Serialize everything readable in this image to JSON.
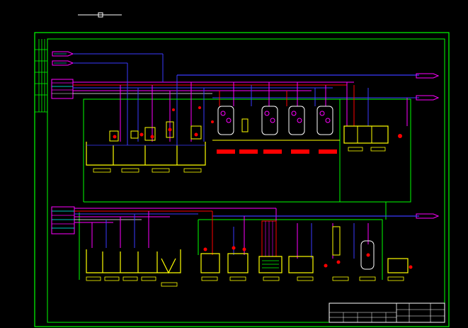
{
  "drawing": {
    "background": "#000000",
    "colors": {
      "frame": "#00ff00",
      "pipe_magenta": "#ff00ff",
      "pipe_red": "#ff0000",
      "pipe_blue": "#3a3aff",
      "vessel": "#ffff00",
      "valve": "#ff0000",
      "white": "#ffffff",
      "cyan": "#00ffff"
    },
    "title_block": {
      "cells": [
        "",
        "",
        "",
        "",
        "",
        "",
        "",
        "",
        ""
      ]
    }
  }
}
